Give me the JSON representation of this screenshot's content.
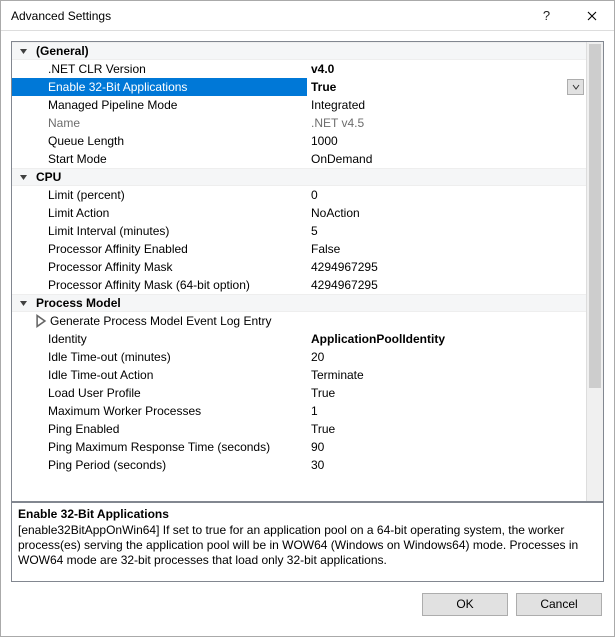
{
  "window": {
    "title": "Advanced Settings"
  },
  "categories": {
    "general": "(General)",
    "cpu": "CPU",
    "process_model": "Process Model"
  },
  "props": {
    "net_clr_version": {
      "label": ".NET CLR Version",
      "value": "v4.0"
    },
    "enable_32bit": {
      "label": "Enable 32-Bit Applications",
      "value": "True"
    },
    "managed_pipeline": {
      "label": "Managed Pipeline Mode",
      "value": "Integrated"
    },
    "name": {
      "label": "Name",
      "value": ".NET v4.5"
    },
    "queue_length": {
      "label": "Queue Length",
      "value": "1000"
    },
    "start_mode": {
      "label": "Start Mode",
      "value": "OnDemand"
    },
    "limit_percent": {
      "label": "Limit (percent)",
      "value": "0"
    },
    "limit_action": {
      "label": "Limit Action",
      "value": "NoAction"
    },
    "limit_interval": {
      "label": "Limit Interval (minutes)",
      "value": "5"
    },
    "affinity_enabled": {
      "label": "Processor Affinity Enabled",
      "value": "False"
    },
    "affinity_mask": {
      "label": "Processor Affinity Mask",
      "value": "4294967295"
    },
    "affinity_mask64": {
      "label": "Processor Affinity Mask (64-bit option)",
      "value": "4294967295"
    },
    "gen_event_log": {
      "label": "Generate Process Model Event Log Entry",
      "value": ""
    },
    "identity": {
      "label": "Identity",
      "value": "ApplicationPoolIdentity"
    },
    "idle_timeout": {
      "label": "Idle Time-out (minutes)",
      "value": "20"
    },
    "idle_timeout_action": {
      "label": "Idle Time-out Action",
      "value": "Terminate"
    },
    "load_user_profile": {
      "label": "Load User Profile",
      "value": "True"
    },
    "max_worker": {
      "label": "Maximum Worker Processes",
      "value": "1"
    },
    "ping_enabled": {
      "label": "Ping Enabled",
      "value": "True"
    },
    "ping_max_response": {
      "label": "Ping Maximum Response Time (seconds)",
      "value": "90"
    },
    "ping_period": {
      "label": "Ping Period (seconds)",
      "value": "30"
    }
  },
  "help": {
    "title": "Enable 32-Bit Applications",
    "text": "[enable32BitAppOnWin64] If set to true for an application pool on a 64-bit operating system, the worker process(es) serving the application pool will be in WOW64 (Windows on Windows64) mode. Processes in WOW64 mode are 32-bit processes that load only 32-bit applications."
  },
  "buttons": {
    "ok": "OK",
    "cancel": "Cancel"
  }
}
